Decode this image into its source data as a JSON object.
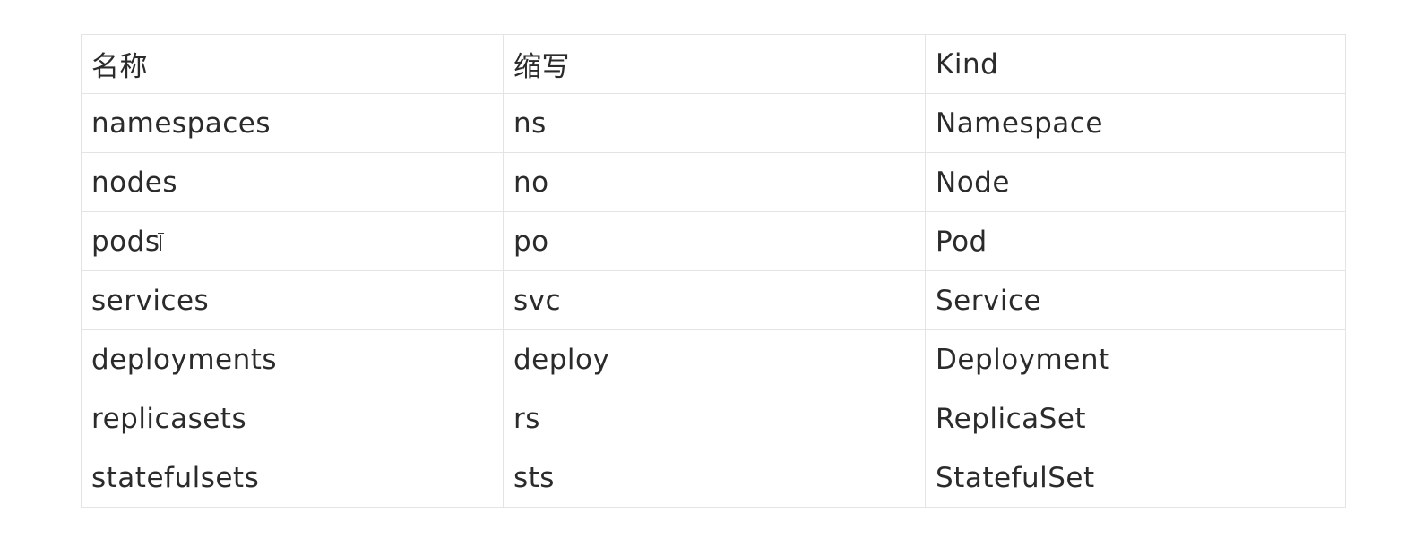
{
  "table": {
    "headers": [
      "名称",
      "缩写",
      "Kind"
    ],
    "rows": [
      [
        "namespaces",
        "ns",
        "Namespace"
      ],
      [
        "nodes",
        "no",
        "Node"
      ],
      [
        "pods",
        "po",
        "Pod"
      ],
      [
        "services",
        "svc",
        "Service"
      ],
      [
        "deployments",
        "deploy",
        "Deployment"
      ],
      [
        "replicasets",
        "rs",
        "ReplicaSet"
      ],
      [
        "statefulsets",
        "sts",
        "StatefulSet"
      ]
    ]
  }
}
